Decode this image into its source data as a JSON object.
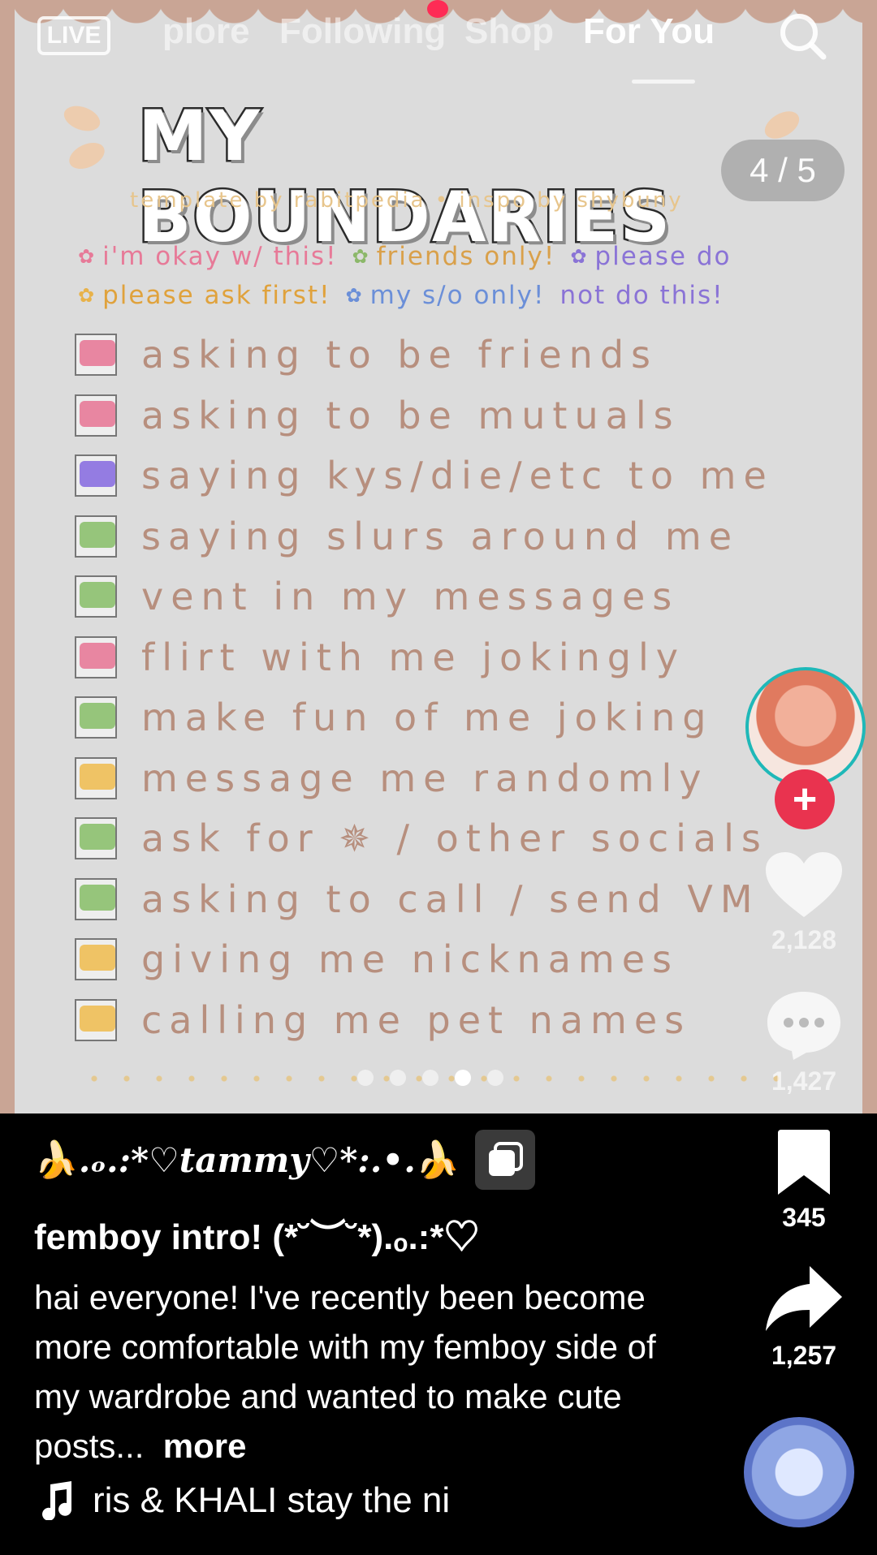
{
  "nav": {
    "live_label": "LIVE",
    "tabs": [
      "plore",
      "Following",
      "Shop",
      "For You"
    ],
    "active_tab": "For You"
  },
  "slide": {
    "title": "MY BOUNDARIES",
    "credit": "template by rabitpedia • inspo by shybuny",
    "legend": [
      {
        "label": "i'm okay w/ this!",
        "color": "#e77a98"
      },
      {
        "label": "friends only!",
        "color": "#8cb86a"
      },
      {
        "label": "please do",
        "color": "#8a73d6"
      },
      {
        "label": "please ask first!",
        "color": "#e8b24a"
      },
      {
        "label": "my s/o only!",
        "color": "#6b8fd8"
      },
      {
        "label": "not do this!",
        "color": "#8a73d6"
      }
    ],
    "items": [
      {
        "text": "asking to be friends",
        "color": "#e77a98"
      },
      {
        "text": "asking to be mutuals",
        "color": "#e77a98"
      },
      {
        "text": "saying kys/die/etc to me",
        "color": "#8a6fe0"
      },
      {
        "text": "saying slurs around me",
        "color": "#8cc06e"
      },
      {
        "text": "vent in my messages",
        "color": "#8cc06e"
      },
      {
        "text": "flirt with me jokingly",
        "color": "#e77a98"
      },
      {
        "text": "make fun of me joking",
        "color": "#8cc06e"
      },
      {
        "text": "message me randomly",
        "color": "#eebe55"
      },
      {
        "text": "ask for ✵ / other socials",
        "color": "#8cc06e"
      },
      {
        "text": "asking to call / send VM",
        "color": "#8cc06e"
      },
      {
        "text": "giving me nicknames",
        "color": "#eebe55"
      },
      {
        "text": "calling me pet names",
        "color": "#eebe55"
      }
    ],
    "page_indicator": "4 / 5",
    "carousel": {
      "total": 5,
      "active": 4
    }
  },
  "rail": {
    "follow_label": "+",
    "likes": "2,128",
    "comments": "1,427",
    "saves": "345",
    "shares": "1,257"
  },
  "caption": {
    "username": ".ₒ.:*♡tammy♡*:.•.",
    "username_emoji": "🍌",
    "title": "femboy intro! (*˘︶˘*).ₒ.:*♡",
    "description": "hai everyone! I've recently been become more comfortable with my femboy side of my wardrobe and wanted to make cute posts...",
    "more_label": "more",
    "music": "ris & KHALI    stay the ni"
  },
  "colors": {
    "accent": "#fe2c55",
    "follow": "#e9334f"
  },
  "icons": [
    "live-icon",
    "search-icon",
    "heart-icon",
    "comment-icon",
    "bookmark-icon",
    "share-icon",
    "music-note-icon",
    "multi-photo-icon"
  ]
}
